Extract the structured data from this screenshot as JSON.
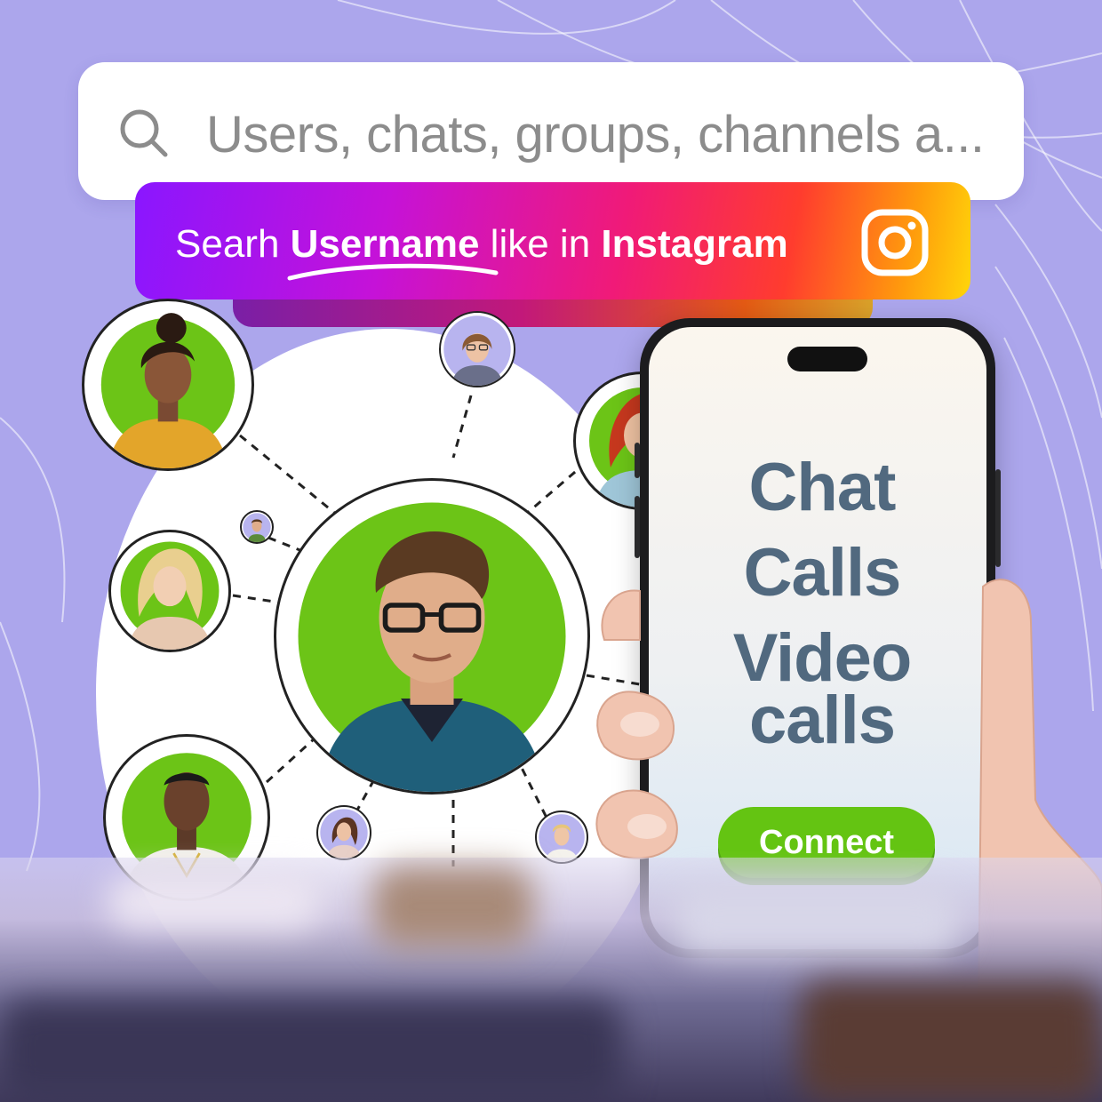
{
  "search": {
    "placeholder": "Users, chats, groups, channels a..."
  },
  "banner": {
    "prefix": "Searh",
    "username_word": "Username",
    "middle": "like in",
    "instagram_word": "Instagram"
  },
  "phone": {
    "features": [
      "Chat",
      "Calls",
      "Video",
      "calls"
    ],
    "connect_label": "Connect"
  },
  "icons": {
    "search": "search-icon",
    "instagram": "instagram-icon"
  },
  "colors": {
    "background": "#ACA6EC",
    "avatar_green": "#6CC417",
    "connect_button": "#64C412",
    "feature_text": "#51697F",
    "banner_gradient": [
      "#8A16FF",
      "#F01A78",
      "#FF9C0C",
      "#FFD60A"
    ]
  }
}
